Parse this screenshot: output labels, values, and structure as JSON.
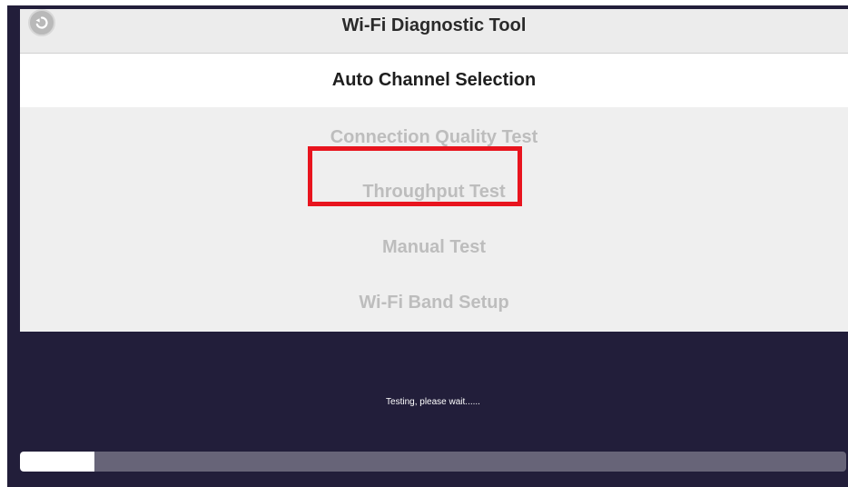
{
  "header": {
    "title": "Wi-Fi Diagnostic Tool",
    "back_icon": "back-arrow-icon"
  },
  "menu": {
    "items": [
      {
        "label": "Auto Channel Selection",
        "selected": true
      },
      {
        "label": "Connection Quality Test",
        "selected": false
      },
      {
        "label": "Throughput Test",
        "selected": false,
        "highlighted": true
      },
      {
        "label": "Manual Test",
        "selected": false
      },
      {
        "label": "Wi-Fi Band Setup",
        "selected": false
      }
    ]
  },
  "status": {
    "message": "Testing, please wait......"
  },
  "progress": {
    "fraction": 0.09
  },
  "colors": {
    "background": "#221e3a",
    "panel": "#efefef",
    "highlight_border": "#e8141e",
    "progress_track": "#676478",
    "progress_fill": "#ffffff"
  }
}
